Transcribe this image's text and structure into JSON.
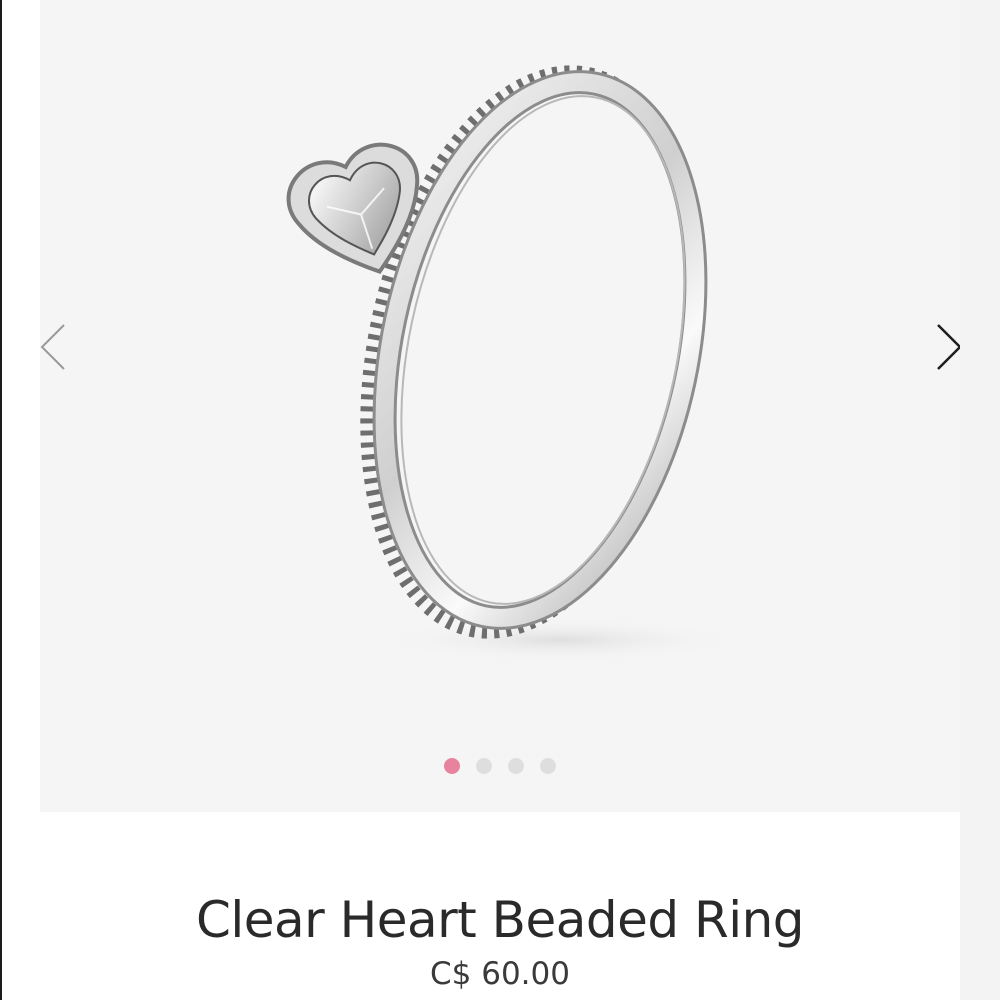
{
  "gallery": {
    "image_alt": "Clear Heart Beaded Ring",
    "prev_icon": "chevron-left-icon",
    "next_icon": "chevron-right-icon",
    "slide_count": 4,
    "active_slide": 1,
    "dot_active_color": "#e8839d",
    "dot_inactive_color": "#dedede"
  },
  "product": {
    "title": "Clear Heart Beaded Ring",
    "price": "C$ 60.00"
  }
}
